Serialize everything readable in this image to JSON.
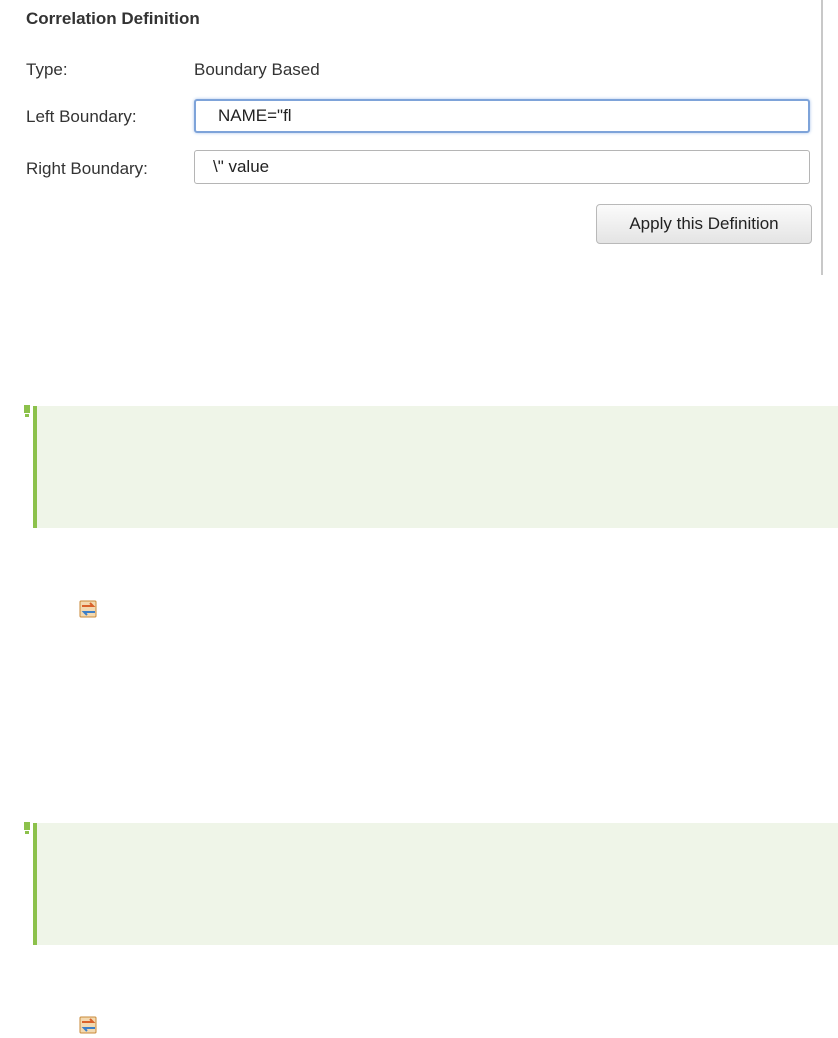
{
  "correlation_definition": {
    "title": "Correlation Definition",
    "type_label": "Type:",
    "type_value": "Boundary Based",
    "left_boundary_label": "Left Boundary:",
    "left_boundary_value": "NAME=\"fl",
    "right_boundary_label": "Right Boundary:",
    "right_boundary_value": "\\\" value",
    "apply_button_label": "Apply this Definition"
  },
  "notes": [
    {
      "icon": "exclamation-icon",
      "accent_color": "#8cc14b",
      "background_color": "#eff5e8"
    },
    {
      "icon": "exclamation-icon",
      "accent_color": "#8cc14b",
      "background_color": "#eff5e8"
    }
  ],
  "inline_icons": [
    "sync-icon",
    "sync-icon"
  ],
  "colors": {
    "focus_border": "#7ea3d9",
    "note_accent": "#8cc14b",
    "note_background": "#eff5e8"
  }
}
